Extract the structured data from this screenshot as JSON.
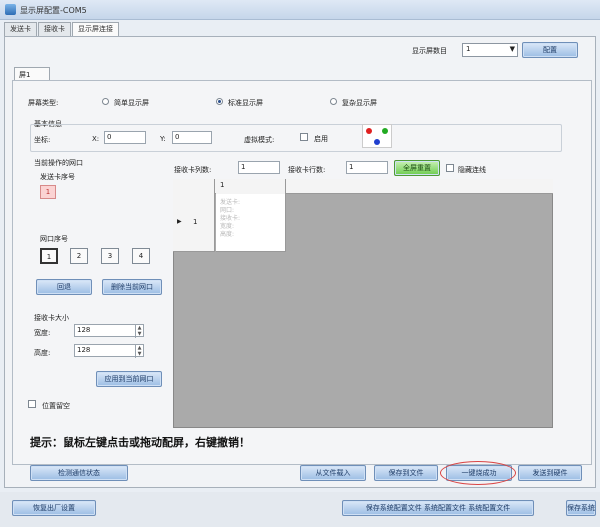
{
  "window": {
    "title": "显示屏配置-COM5"
  },
  "top_tabs": [
    "发送卡",
    "接收卡",
    "显示屏连接"
  ],
  "screen_select": {
    "label": "显示屏数目",
    "value": "1",
    "config_button": "配置"
  },
  "inner_tab": "屏1",
  "screen_type": {
    "label": "屏幕类型:",
    "options": [
      "简单显示屏",
      "标准显示屏",
      "复杂显示屏"
    ],
    "selected": "标准显示屏"
  },
  "basic_info": {
    "label": "基本信息",
    "coord_label": "坐标:",
    "x_label": "X:",
    "x_value": "0",
    "y_label": "Y:",
    "y_value": "0",
    "virtual_mode_label": "虚拟模式:",
    "enable_label": "启用"
  },
  "dot_colors": {
    "red": "#e02020",
    "green": "#22aa22",
    "blue": "#1f3fcf"
  },
  "port_section": {
    "current_port_label": "当前操作的网口",
    "sender_no_label": "发送卡序号",
    "sender_no_value": "1",
    "port_no_label": "网口序号",
    "ports": [
      "1",
      "2",
      "3",
      "4"
    ],
    "selected_port": "1",
    "btn_back": "回退",
    "btn_delete_port": "删除当前网口"
  },
  "receiver_size": {
    "label": "接收卡大小",
    "width_label": "宽度:",
    "width_value": "128",
    "height_label": "高度:",
    "height_value": "128",
    "apply_button": "应用到当前网口"
  },
  "position_reserve_label": "位置留空",
  "grid_controls": {
    "cols_label": "接收卡列数:",
    "cols_value": "1",
    "rows_label": "接收卡行数:",
    "rows_value": "1",
    "full_reset_button": "全屏重置",
    "hide_lines_label": "隐藏连线"
  },
  "grid": {
    "col_header": "1",
    "row_header": "1",
    "cell_lines": [
      "发送卡:",
      "网口:",
      "接收卡:",
      "宽度:",
      "高度:"
    ]
  },
  "hint": "提示：鼠标左键点击或拖动配屏，右键撤销！",
  "action_buttons": {
    "detect_comm": "检测通信状态",
    "load_from_file": "从文件载入",
    "save_to_file": "保存到文件",
    "one_key_success": "一键烧成功",
    "send_to_hardware": "发送到硬件"
  },
  "bottom_buttons": {
    "restore_factory": "恢复出厂设置",
    "save_all_configs": "保存系统配置文件 系统配置文件 系统配置文件",
    "save_partial": "保存系统"
  }
}
